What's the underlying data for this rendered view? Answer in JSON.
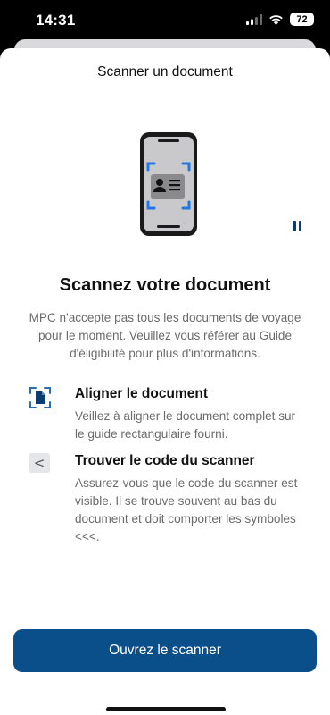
{
  "status_bar": {
    "time": "14:31",
    "battery": "72"
  },
  "sheet": {
    "title": "Scanner un document"
  },
  "main": {
    "heading": "Scannez votre document",
    "intro": "MPC n'accepte pas tous les documents de voyage pour le moment. Veuillez vous référer au Guide d'éligibilité pour plus d'informations.",
    "steps": [
      {
        "title": "Aligner le document",
        "text": "Veillez à aligner le document complet sur le guide rectangulaire fourni.",
        "icon": "document-scan-icon"
      },
      {
        "title": "Trouver le code du scanner",
        "text": "Assurez-vous que le code du scanner est visible. Il se trouve souvent au bas du document et doit comporter les symboles <<<.",
        "icon_text": "<"
      }
    ]
  },
  "actions": {
    "primary_label": "Ouvrez le scanner"
  },
  "colors": {
    "primary": "#0b4f8a",
    "scan_frame": "#1e78e6",
    "pause": "#0b3d6e"
  }
}
